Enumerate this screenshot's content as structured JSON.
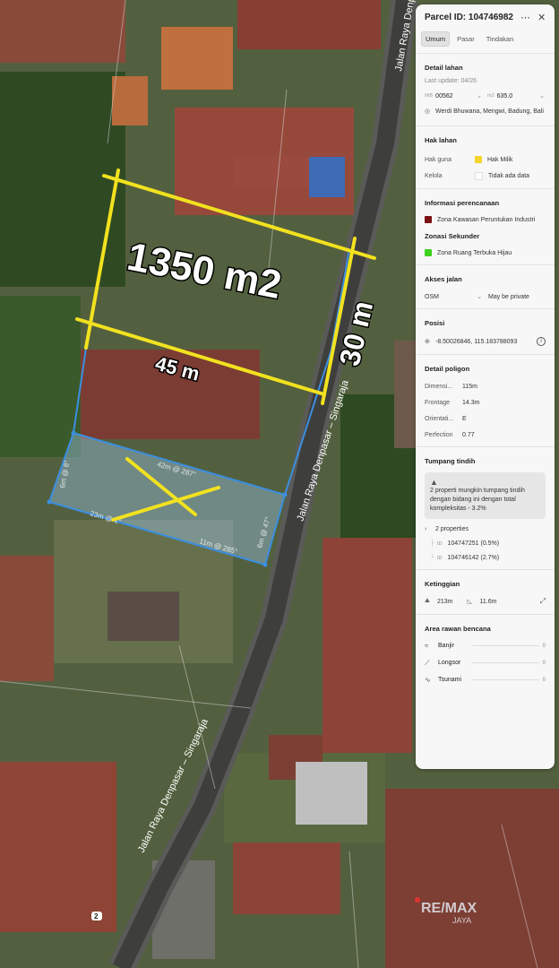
{
  "map": {
    "area_label": "1350 m2",
    "width_label": "45 m",
    "depth_label": "30 m",
    "road_label_top": "Jalan Raya Denpas",
    "road_label_mid": "Jalan Raya Denpasar – Singaraja",
    "road_label_bottom": "Jalan Raya Denpasar – Singaraja",
    "route_number": "2",
    "parcel_edge_top": "42m @ 287°",
    "parcel_edge_left": "6m @ 8°",
    "parcel_edge_bottom_left": "23m @ 1°",
    "parcel_edge_right": "6m @ 47°",
    "parcel_edge_bottom": "11m @ 285°",
    "watermark_brand": "RE/MAX",
    "watermark_sub": "JAYA"
  },
  "panel": {
    "title": "Parcel ID: 104746982",
    "tabs": [
      "Umum",
      "Pasar",
      "Tindakan"
    ],
    "detail": {
      "heading": "Detail lahan",
      "last_update": "Last update: 04/26",
      "nib_prefix": "NIB",
      "nib_value": "00562",
      "m2_prefix": "m2",
      "m2_value": "635.0",
      "address": "Werdi Bhuwana, Mengwi, Badung, Bali"
    },
    "hak": {
      "heading": "Hak lahan",
      "guna_label": "Hak guna",
      "guna_value": "Hak Milik",
      "kelola_label": "Kelola",
      "kelola_value": "Tidak ada data"
    },
    "planning": {
      "heading": "Informasi perencanaan",
      "zone": "Zona Kawasan Peruntukan Industri",
      "secondary_heading": "Zonasi Sekunder",
      "secondary_zone": "Zona Ruang Terbuka Hijau"
    },
    "akses": {
      "heading": "Akses jalan",
      "source": "OSM",
      "value": "May be private"
    },
    "posisi": {
      "heading": "Posisi",
      "coords": "-8.50026846, 115.183788093"
    },
    "poligon": {
      "heading": "Detail poligon",
      "rows": [
        {
          "label": "Dimensi...",
          "value": "115m"
        },
        {
          "label": "Frontage",
          "value": "14.3m"
        },
        {
          "label": "Orientati...",
          "value": "E"
        },
        {
          "label": "Perfection",
          "value": "0.77"
        }
      ]
    },
    "tumpang": {
      "heading": "Tumpang tindih",
      "note": "2 properti mungkin tumpang tindih dengan bidang ini dengan total kompleksitas - 3.2%",
      "toggle": "2 properties",
      "id_prefix": "ID",
      "items": [
        "104747251 (0.5%)",
        "104746142 (2.7%)"
      ]
    },
    "ketinggian": {
      "heading": "Ketinggian",
      "elev": "213m",
      "slope": "11.6m"
    },
    "bencana": {
      "heading": "Area rawan bencana",
      "items": [
        {
          "name": "Banjir",
          "value": "0"
        },
        {
          "name": "Longsor",
          "value": "0"
        },
        {
          "name": "Tsunami",
          "value": "0"
        }
      ]
    }
  },
  "colors": {
    "plot_yellow": "#f2e21f",
    "parcel_blue": "#3b8fe0",
    "hak_milik": "#f4d32a",
    "zone_industri": "#7a1212",
    "zone_hijau": "#3fd11f"
  }
}
